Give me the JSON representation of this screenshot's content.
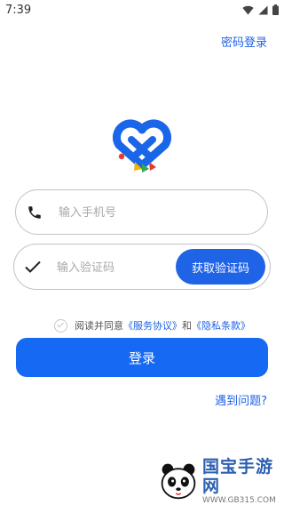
{
  "status_bar": {
    "time": "7:39"
  },
  "header": {
    "password_login": "密码登录"
  },
  "phone_field": {
    "placeholder": "输入手机号"
  },
  "code_field": {
    "placeholder": "输入验证码",
    "button_label": "获取验证码"
  },
  "agreement": {
    "prefix": "阅读并同意",
    "service_link": "《服务协议》",
    "conjunction": "和",
    "privacy_link": "《隐私条款》",
    "checked": false
  },
  "login_button": {
    "label": "登录"
  },
  "help_link": {
    "label": "遇到问题?"
  },
  "watermark": {
    "name": "国宝手游网",
    "url": "WWW.GB315.COM"
  },
  "colors": {
    "accent": "#1f63e6",
    "button": "#1669f2"
  },
  "icons": [
    "wifi-icon",
    "signal-icon",
    "battery-icon",
    "heart-logo-icon",
    "phone-icon",
    "check-icon",
    "agree-check-icon",
    "panda-logo-icon"
  ]
}
